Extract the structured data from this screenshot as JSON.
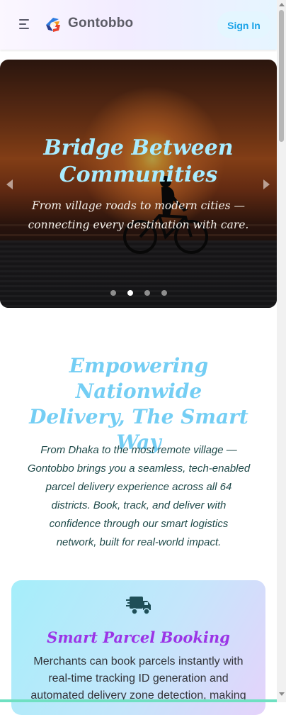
{
  "header": {
    "brand": "Gontobbo",
    "signin_label": "Sign In"
  },
  "hero": {
    "title_line1": "Bridge Between",
    "title_line2": "Communities",
    "subtitle_line1": "From village roads to modern cities —",
    "subtitle_line2": "connecting every destination with care.",
    "slide_count": 4,
    "active_slide": 2
  },
  "section": {
    "title_line1": "Empowering Nationwide",
    "title_line2": "Delivery, The Smart",
    "title_line3": "Way",
    "description_lines": [
      "From Dhaka to the most remote village —",
      "Gontobbo brings you a seamless, tech-enabled",
      "parcel delivery experience across all 64",
      "districts. Book, track, and deliver with",
      "confidence through our smart logistics",
      "network, built for real-world impact."
    ]
  },
  "feature_card": {
    "icon": "shipping-truck-icon",
    "title": "Smart Parcel Booking",
    "description_lines": [
      "Merchants can book parcels instantly with",
      "real-time tracking ID generation and",
      "automated delivery zone detection, making"
    ]
  },
  "colors": {
    "accent_blue": "#1aa3e8",
    "title_cyan": "#74cef4",
    "card_title_purple": "#9b35e6"
  }
}
